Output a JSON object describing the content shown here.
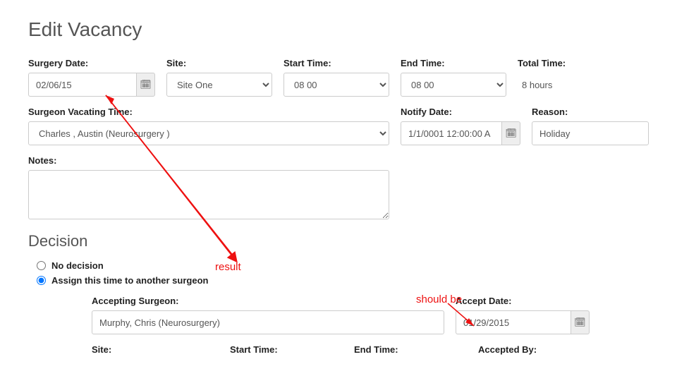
{
  "title": "Edit Vacancy",
  "row1": {
    "surgery_date_label": "Surgery Date:",
    "surgery_date_value": "02/06/15",
    "site_label": "Site:",
    "site_value": "Site One",
    "start_time_label": "Start Time:",
    "start_time_value": "08 00",
    "end_time_label": "End Time:",
    "end_time_value": "08 00",
    "total_time_label": "Total Time:",
    "total_time_value": "8 hours"
  },
  "row2": {
    "surgeon_label": "Surgeon Vacating Time:",
    "surgeon_value": "Charles , Austin (Neurosurgery )",
    "notify_label": "Notify Date:",
    "notify_value": "1/1/0001 12:00:00 A",
    "reason_label": "Reason:",
    "reason_value": "Holiday"
  },
  "notes_label": "Notes:",
  "decision": {
    "heading": "Decision",
    "opt_no": "No decision",
    "opt_assign": "Assign this time to another surgeon",
    "accepting_label": "Accepting Surgeon:",
    "accepting_value": "Murphy, Chris (Neurosurgery)",
    "accept_date_label": "Accept Date:",
    "accept_date_value": "01/29/2015",
    "sub_site": "Site:",
    "sub_start": "Start Time:",
    "sub_end": "End Time:",
    "sub_accepted_by": "Accepted By:"
  },
  "icons": {
    "calendar": "🗓"
  },
  "annotations": {
    "result": "result",
    "should_be": "should be"
  }
}
